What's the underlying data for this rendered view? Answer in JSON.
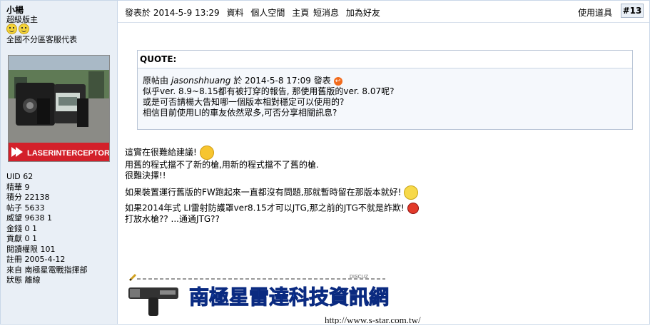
{
  "author": {
    "name": "小楊",
    "title": "超級版主",
    "custom_title": "全國不分區客服代表",
    "avatar_text": "LASERINTERCEPTOR",
    "stats": [
      {
        "label": "UID",
        "value": "62"
      },
      {
        "label": "精華",
        "value": "9"
      },
      {
        "label": "積分",
        "value": "22138"
      },
      {
        "label": "帖子",
        "value": "5633"
      },
      {
        "label": "威望",
        "value": "9638 1"
      },
      {
        "label": "金錢",
        "value": "0 1"
      },
      {
        "label": "貢獻",
        "value": "0 1"
      },
      {
        "label": "閱讀權限",
        "value": "101"
      },
      {
        "label": "註冊",
        "value": "2005-4-12"
      },
      {
        "label": "來自",
        "value": "南極星電戰指揮部"
      },
      {
        "label": "狀態",
        "value": "離線"
      }
    ]
  },
  "post": {
    "posted_at": "發表於 2014-5-9 13:29",
    "links": [
      "資料",
      "個人空間",
      "主頁",
      "短消息",
      "加為好友"
    ],
    "tools": "使用道具",
    "floor": "#13"
  },
  "quote": {
    "header": "QUOTE:",
    "origin_prefix": "原帖由",
    "origin_user": "jasonshhuang",
    "origin_suffix": "於 2014-5-8 17:09 發表",
    "lines": [
      "似乎ver. 8.9~8.15都有被打穿的報告, 那使用舊版的ver. 8.07呢?",
      "或是可否請楊大告知哪一個版本相對穩定可以使用的?",
      "相信目前使用LI的車友依然眾多,可否分享相關訊息?"
    ]
  },
  "message": {
    "p1": [
      "這實在很難給建議!",
      "用舊的程式擋不了新的槍,用新的程式擋不了舊的槍.",
      "很難決擇!!"
    ],
    "p2": "如果裝置運行舊版的FW跑起來一直都沒有問題,那就暫時留在那版本就好!",
    "p3": [
      "如果2014年式 LI雷射防護罩ver8.15才可以JTG,那之前的JTG不就是詐欺!",
      "打放水槍?? ...通通JTG??"
    ]
  },
  "signature": {
    "tag": "DISCUZ",
    "banner": "南極星雷達科技資訊網",
    "url": "http://www.s-star.com.tw/"
  },
  "colors": {
    "sidebar_bg": "#e9eff6",
    "border": "#c9d7e8",
    "banner_blue": "#1f54c8",
    "laser_red": "#d3202a"
  }
}
